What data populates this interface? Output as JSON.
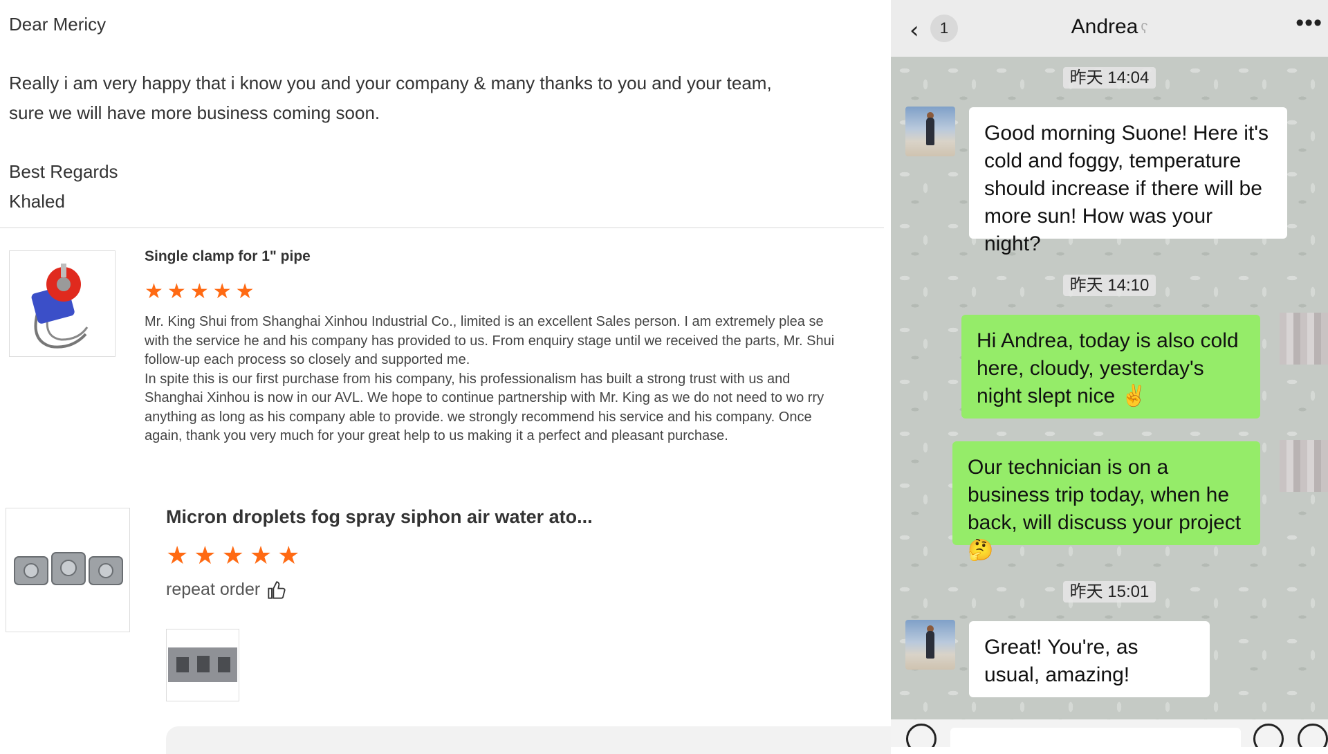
{
  "email": {
    "greeting": "Dear Mericy",
    "line1": "Really i am very happy that i know you and your company & many thanks to you and your team,",
    "line2": "sure we will have more business coming soon.",
    "closing": "Best Regards",
    "signature": "Khaled"
  },
  "reviews": [
    {
      "product_title": "Single clamp for 1\" pipe",
      "rating": 5,
      "text": "Mr. King Shui from Shanghai Xinhou Industrial Co., limited is an excellent Sales person. I am extremely plea se with the service he and his company has provided to us. From enquiry stage until we received the parts, Mr. Shui follow-up each process so closely and supported me.\nIn spite this is our first purchase from his company, his professionalism has built a strong trust with us and Shanghai Xinhou is now in our AVL. We hope to continue partnership with Mr. King as we do not need to wo rry anything as long as his company able to provide. we strongly recommend his service and his company. Once again, thank you very much for your great help to us making it a perfect and pleasant purchase."
    },
    {
      "product_title": "Micron droplets fog spray siphon air water ato...",
      "rating": 5,
      "text": "repeat order"
    }
  ],
  "chat": {
    "contact_name": "Andrea",
    "unread_count": "1",
    "messages": [
      {
        "timestamp": "昨天 14:04",
        "direction": "in",
        "text": "Good morning Suone! Here it's cold and foggy, temperature should increase if there will be more sun! How was your night?"
      },
      {
        "timestamp": "昨天 14:10",
        "direction": "out",
        "text": "Hi Andrea,  today is also cold here,  cloudy,  yesterday's night slept nice ✌️"
      },
      {
        "direction": "out",
        "text": "Our technician is on a business trip today,  when he back, will discuss your project🤔"
      },
      {
        "timestamp": "昨天 15:01",
        "direction": "in",
        "text": "Great! You're, as usual, amazing!"
      }
    ]
  },
  "colors": {
    "star": "#ff6a13",
    "outgoing_bubble": "#95ec69",
    "incoming_bubble": "#ffffff",
    "chat_background": "#c6cbc6"
  },
  "icons": {
    "back": "chevron-left-icon",
    "mute": "ear-icon",
    "more": "more-dots-icon",
    "thumbs_up": "thumbs-up-icon",
    "star": "star-icon"
  }
}
